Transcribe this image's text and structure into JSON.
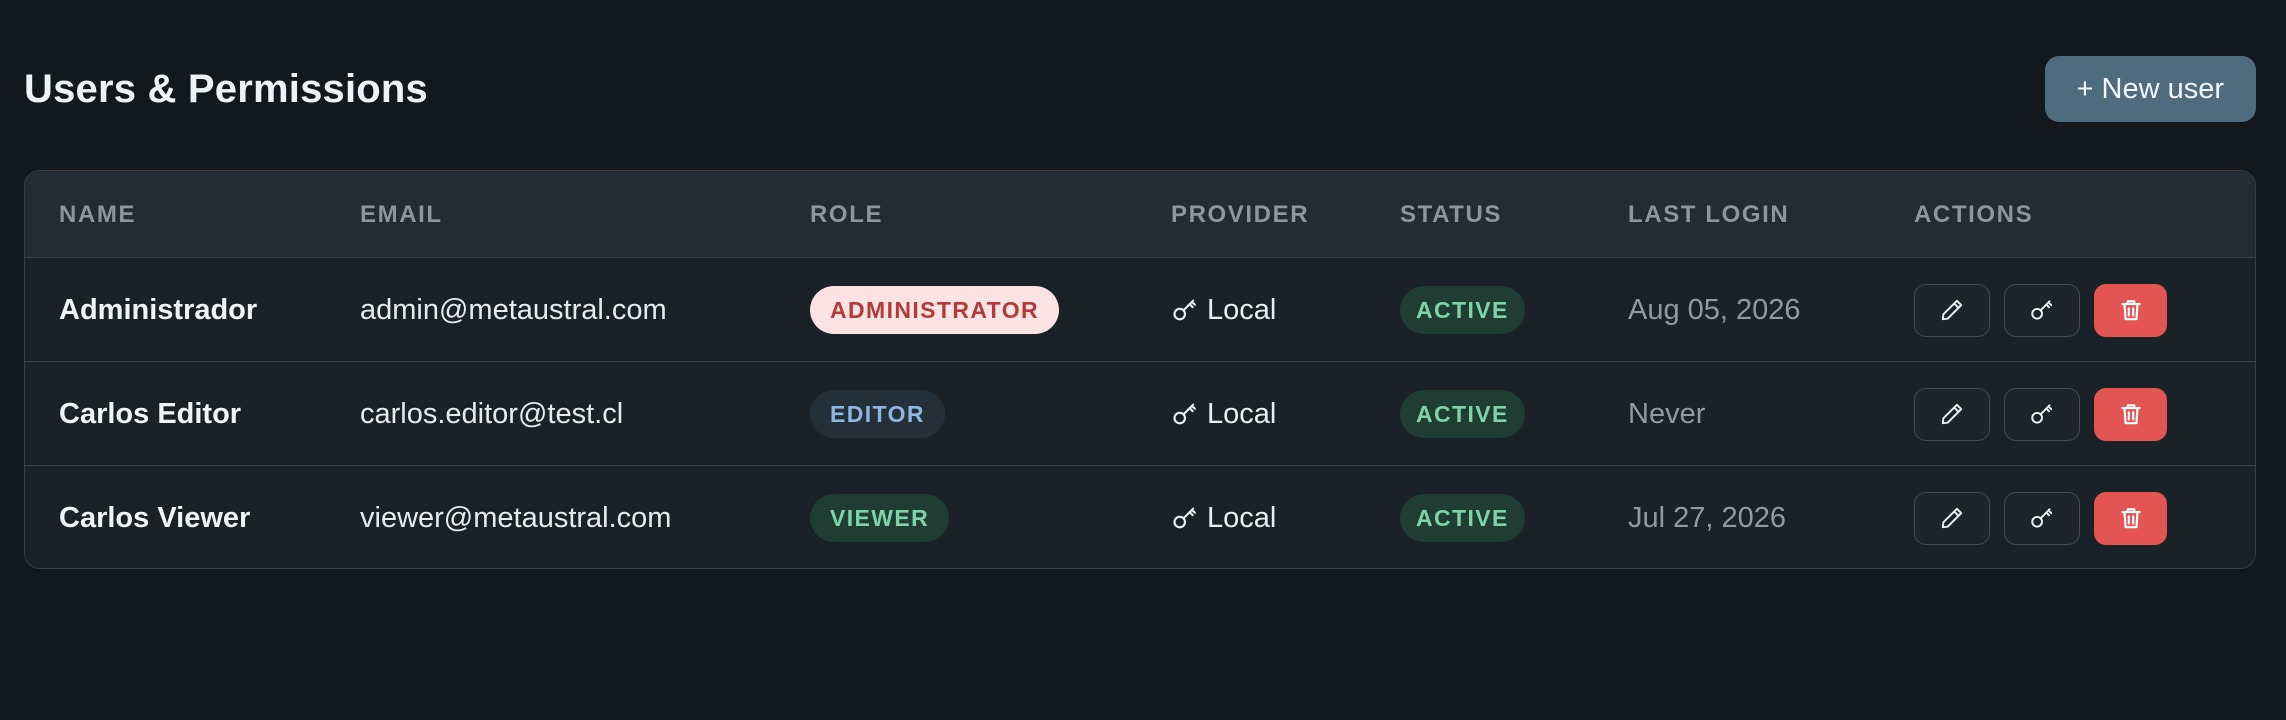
{
  "header": {
    "title": "Users & Permissions",
    "new_user_label": "+ New user"
  },
  "table": {
    "columns": {
      "name": "NAME",
      "email": "EMAIL",
      "role": "ROLE",
      "provider": "PROVIDER",
      "status": "STATUS",
      "last_login": "LAST LOGIN",
      "actions": "ACTIONS"
    },
    "rows": [
      {
        "name": "Administrador",
        "email": "admin@metaustral.com",
        "role": "ADMINISTRATOR",
        "role_bg": "#fbe3e3",
        "role_color": "#b23a3a",
        "provider": "Local",
        "status": "ACTIVE",
        "last_login": "Aug 05, 2026"
      },
      {
        "name": "Carlos Editor",
        "email": "carlos.editor@test.cl",
        "role": "EDITOR",
        "role_bg": "#243039",
        "role_color": "#8fb6e0",
        "provider": "Local",
        "status": "ACTIVE",
        "last_login": "Never"
      },
      {
        "name": "Carlos Viewer",
        "email": "viewer@metaustral.com",
        "role": "VIEWER",
        "role_bg": "#1f3d33",
        "role_color": "#7fd3a8",
        "provider": "Local",
        "status": "ACTIVE",
        "last_login": "Jul 27, 2026"
      }
    ]
  },
  "icons": {
    "provider": "key-icon",
    "edit": "pencil-icon",
    "reset_password": "key-icon",
    "delete": "trash-icon"
  },
  "colors": {
    "background": "#13181c",
    "primary_button": "#4e6b80",
    "delete_button": "#e25553",
    "active_badge_bg": "#1f3d33",
    "active_badge_text": "#7fd3a8"
  }
}
